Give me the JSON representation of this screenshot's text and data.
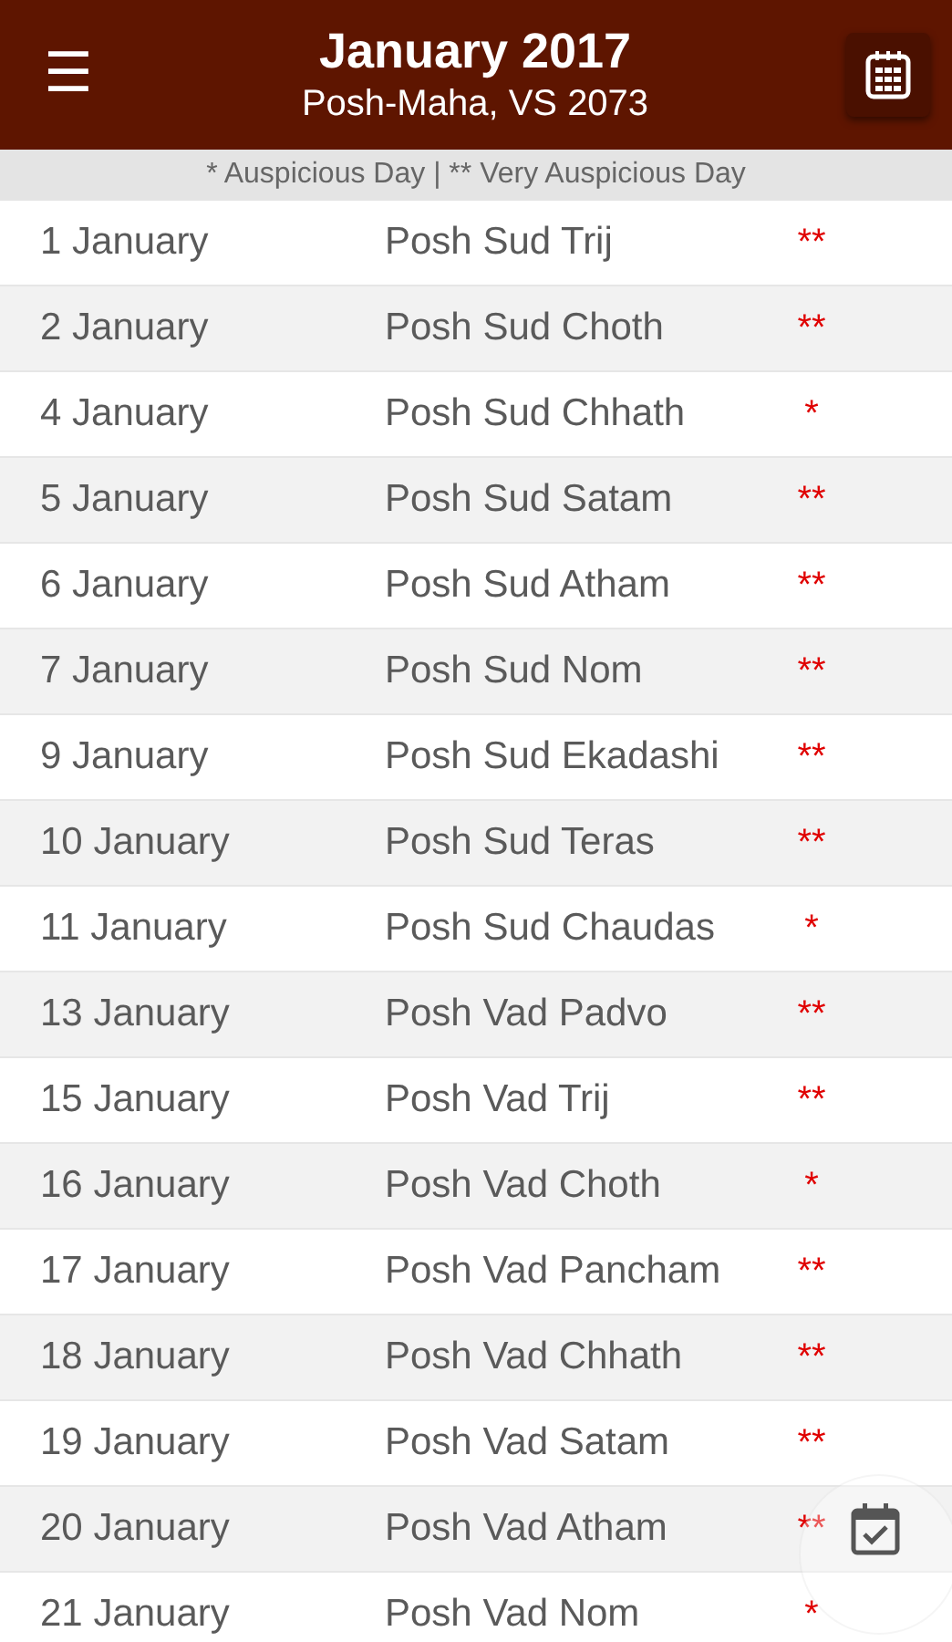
{
  "header": {
    "menu": "☰",
    "title": "January 2017",
    "subtitle": "Posh-Maha, VS 2073"
  },
  "legend": "* Auspicious Day | ** Very Auspicious Day",
  "rows": [
    {
      "date": "1 January",
      "tithi": "Posh Sud Trij",
      "mark": "**"
    },
    {
      "date": "2 January",
      "tithi": "Posh Sud Choth",
      "mark": "**"
    },
    {
      "date": "4 January",
      "tithi": "Posh Sud Chhath",
      "mark": "*"
    },
    {
      "date": "5 January",
      "tithi": "Posh Sud Satam",
      "mark": "**"
    },
    {
      "date": "6 January",
      "tithi": "Posh Sud Atham",
      "mark": "**"
    },
    {
      "date": "7 January",
      "tithi": "Posh Sud Nom",
      "mark": "**"
    },
    {
      "date": "9 January",
      "tithi": "Posh Sud Ekadashi",
      "mark": "**"
    },
    {
      "date": "10 January",
      "tithi": "Posh Sud Teras",
      "mark": "**"
    },
    {
      "date": "11 January",
      "tithi": "Posh Sud Chaudas",
      "mark": "*"
    },
    {
      "date": "13 January",
      "tithi": "Posh Vad Padvo",
      "mark": "**"
    },
    {
      "date": "15 January",
      "tithi": "Posh Vad Trij",
      "mark": "**"
    },
    {
      "date": "16 January",
      "tithi": "Posh Vad Choth",
      "mark": "*"
    },
    {
      "date": "17 January",
      "tithi": "Posh Vad Pancham",
      "mark": "**"
    },
    {
      "date": "18 January",
      "tithi": "Posh Vad Chhath",
      "mark": "**"
    },
    {
      "date": "19 January",
      "tithi": "Posh Vad Satam",
      "mark": "**"
    },
    {
      "date": "20 January",
      "tithi": "Posh Vad Atham",
      "mark": "**"
    },
    {
      "date": "21 January",
      "tithi": "Posh Vad Nom",
      "mark": "*"
    }
  ]
}
